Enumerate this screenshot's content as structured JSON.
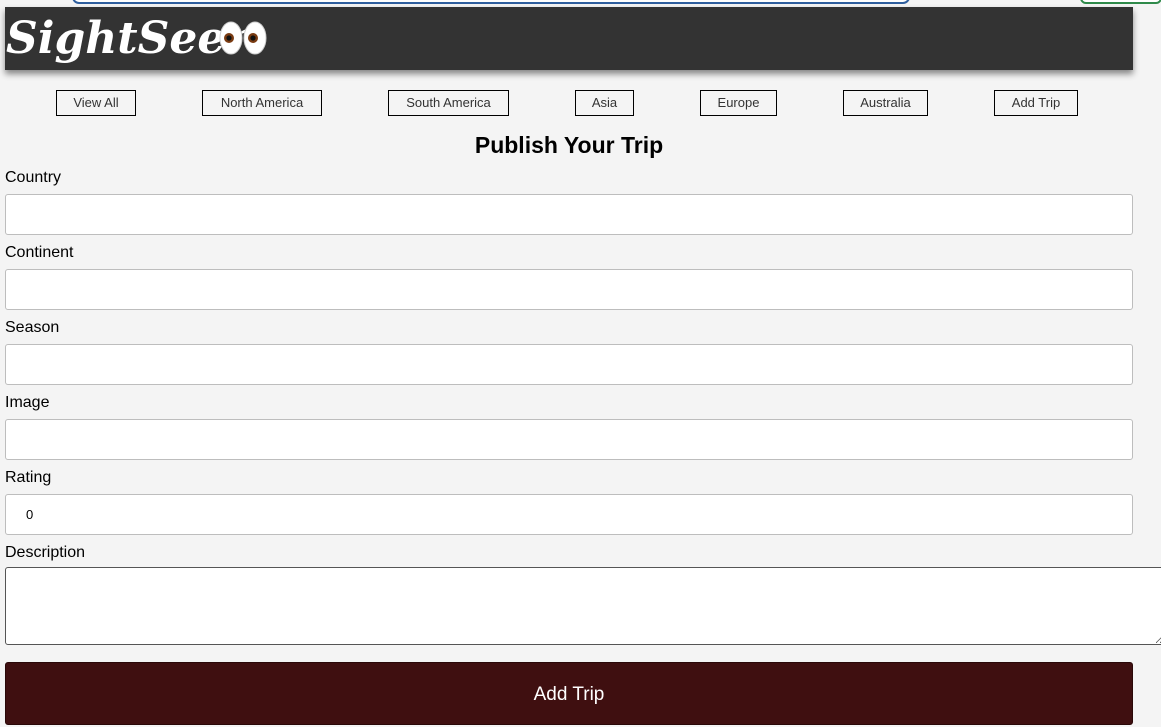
{
  "app": {
    "brand": "SightSeer",
    "brand_icon": "eyes-emoji-icon"
  },
  "nav": {
    "items": [
      {
        "label": "View All"
      },
      {
        "label": "North America"
      },
      {
        "label": "South America"
      },
      {
        "label": "Asia"
      },
      {
        "label": "Europe"
      },
      {
        "label": "Australia"
      },
      {
        "label": "Add Trip"
      }
    ]
  },
  "form": {
    "title": "Publish Your Trip",
    "fields": {
      "country": {
        "label": "Country",
        "value": ""
      },
      "continent": {
        "label": "Continent",
        "value": ""
      },
      "season": {
        "label": "Season",
        "value": ""
      },
      "image": {
        "label": "Image",
        "value": ""
      },
      "rating": {
        "label": "Rating",
        "value": "0"
      },
      "description": {
        "label": "Description",
        "value": ""
      }
    },
    "submit_label": "Add Trip"
  },
  "colors": {
    "header_bg": "#333333",
    "submit_bg": "#3f0f10",
    "page_bg": "#f4f4f4"
  }
}
